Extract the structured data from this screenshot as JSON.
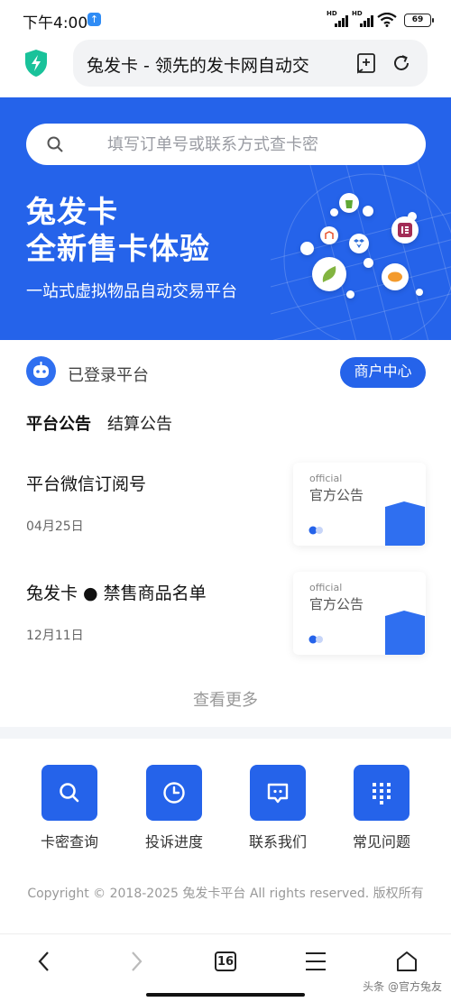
{
  "status_bar": {
    "time": "下午4:00",
    "app_badge": "↑",
    "signal_1_label": "HD",
    "signal_2_label": "HD",
    "battery": "69"
  },
  "browser": {
    "url_title": "兔发卡 - 领先的发卡网自动交",
    "tab_count": "16"
  },
  "hero": {
    "search_placeholder": "填写订单号或联系方式查卡密",
    "title_line1": "兔发卡",
    "title_line2": "全新售卡体验",
    "subtitle": "一站式虚拟物品自动交易平台"
  },
  "account": {
    "status_label": "已登录平台",
    "merchant_button": "商户中心"
  },
  "tabs": [
    {
      "label": "平台公告",
      "active": true
    },
    {
      "label": "结算公告",
      "active": false
    }
  ],
  "news": [
    {
      "title": "平台微信订阅号",
      "date": "04月25日",
      "thumb_en": "official",
      "thumb_cn": "官方公告"
    },
    {
      "title": "兔发卡 ● 禁售商品名单",
      "date": "12月11日",
      "thumb_en": "official",
      "thumb_cn": "官方公告"
    }
  ],
  "see_more": "查看更多",
  "quick_links": [
    {
      "label": "卡密查询",
      "icon": "search-icon"
    },
    {
      "label": "投诉进度",
      "icon": "clock-icon"
    },
    {
      "label": "联系我们",
      "icon": "chat-icon"
    },
    {
      "label": "常见问题",
      "icon": "keypad-icon"
    }
  ],
  "footer": {
    "copyright": "Copyright © 2018-2025 兔发卡平台 All rights reserved. 版权所有"
  },
  "watermark": "头条 @官方兔友",
  "colors": {
    "brand_blue": "#2563ea",
    "hero_bg": "#2563ea",
    "muted_text": "#999999"
  }
}
